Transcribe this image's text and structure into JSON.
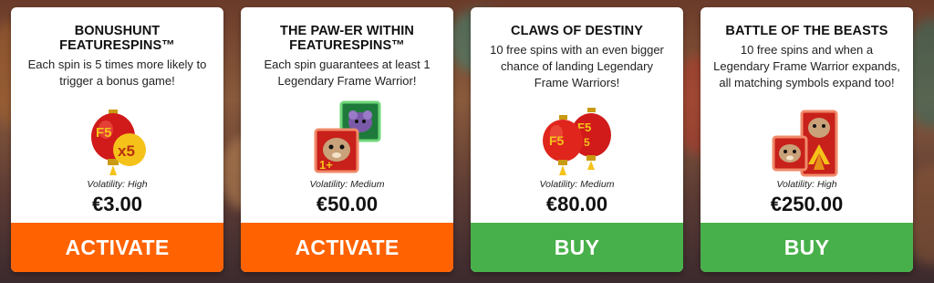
{
  "colors": {
    "activate": "#ff6200",
    "buy": "#48b04a",
    "lantern_red": "#d11a1a",
    "lantern_gold": "#f5c21a"
  },
  "cards": [
    {
      "title": "BONUSHUNT\nFEATURESPINS™",
      "description": "Each spin is 5 times more likely to\ntrigger a bonus game!",
      "art_icon": "lantern-fs-x5-icon",
      "volatility": "Volatility: High",
      "price": "€3.00",
      "action_label": "ACTIVATE"
    },
    {
      "title": "THE PAW-ER WITHIN\nFEATURESPINS™",
      "description": "Each spin guarantees at least 1\nLegendary Frame Warrior!",
      "art_icon": "frame-warrior-symbols-icon",
      "volatility": "Volatility: Medium",
      "price": "€50.00",
      "action_label": "ACTIVATE"
    },
    {
      "title": "CLAWS OF DESTINY",
      "description": "10 free spins with an even bigger\nchance of landing Legendary\nFrame Warriors!",
      "art_icon": "double-lantern-fs-icon",
      "volatility": "Volatility: Medium",
      "price": "€80.00",
      "action_label": "BUY"
    },
    {
      "title": "BATTLE OF THE BEASTS",
      "description": "10 free spins and when a\nLegendary Frame Warrior expands,\nall matching symbols expand too!",
      "art_icon": "expanding-warrior-symbols-icon",
      "volatility": "Volatility: High",
      "price": "€250.00",
      "action_label": "BUY"
    }
  ]
}
